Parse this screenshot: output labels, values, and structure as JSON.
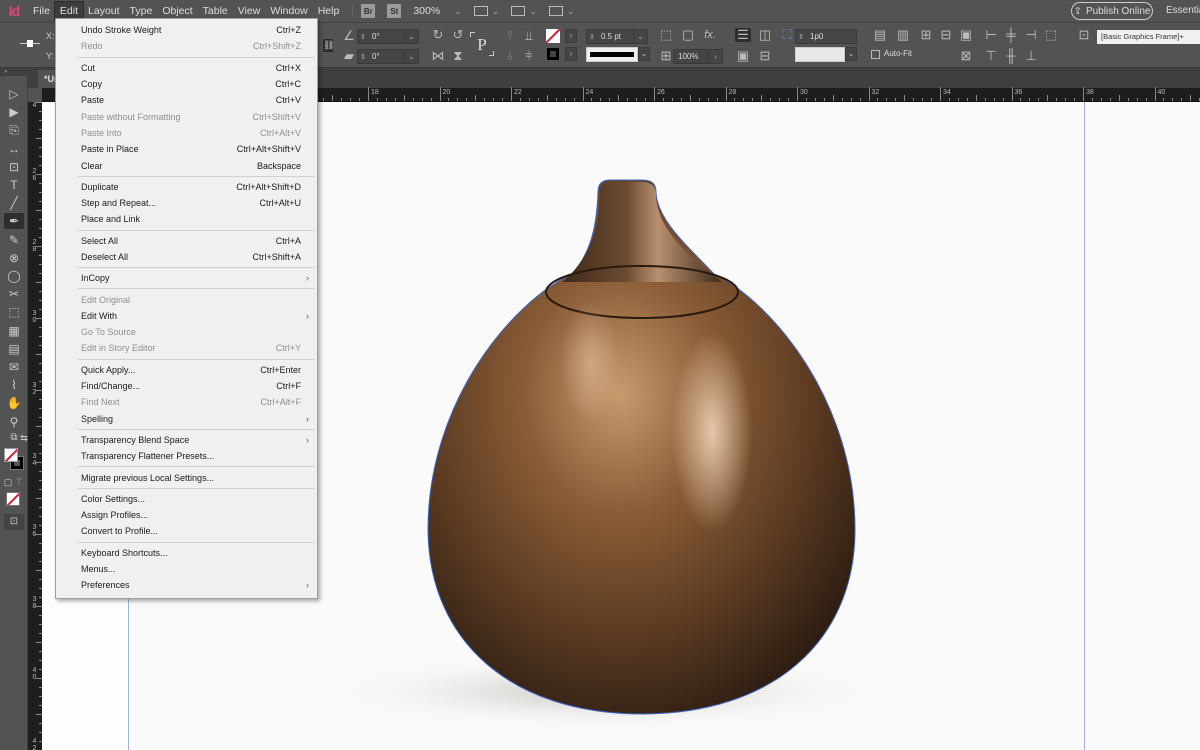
{
  "app": {
    "logo": "Id",
    "name": "Adobe InDesign"
  },
  "menubar": {
    "items": [
      "File",
      "Edit",
      "Layout",
      "Type",
      "Object",
      "Table",
      "View",
      "Window",
      "Help"
    ],
    "active": "Edit",
    "bridge_label": "Br",
    "stock_label": "St",
    "zoom_level": "300%",
    "publish_label": "Publish Online",
    "workspace_label": "Essentials"
  },
  "control_panel": {
    "x_label": "X:",
    "y_label": "Y:",
    "rotate_angle": "0°",
    "shear_angle": "0°",
    "stroke_weight": "0.5 pt",
    "opacity": "100%",
    "corner_size": "1p0",
    "autofit_label": "Auto-Fit",
    "autofit_checked": false,
    "object_style": "[Basic Graphics Frame]+",
    "fill_color": "none",
    "stroke_color": "#000000",
    "type_on_path_label": "P",
    "fx_label": "fx."
  },
  "document": {
    "tab_label": "*Un",
    "tools_header": "»"
  },
  "rulers": {
    "horizontal": [
      "18",
      "20",
      "22",
      "24",
      "26",
      "28",
      "30",
      "32",
      "34",
      "36",
      "38",
      "40"
    ],
    "vertical": [
      "4",
      "26",
      "28",
      "30",
      "32",
      "34",
      "36",
      "38",
      "40",
      "42"
    ]
  },
  "edit_menu": {
    "groups": [
      [
        {
          "label": "Undo Stroke Weight",
          "shortcut": "Ctrl+Z",
          "enabled": true
        },
        {
          "label": "Redo",
          "shortcut": "Ctrl+Shift+Z",
          "enabled": false
        }
      ],
      [
        {
          "label": "Cut",
          "shortcut": "Ctrl+X",
          "enabled": true
        },
        {
          "label": "Copy",
          "shortcut": "Ctrl+C",
          "enabled": true
        },
        {
          "label": "Paste",
          "shortcut": "Ctrl+V",
          "enabled": true
        },
        {
          "label": "Paste without Formatting",
          "shortcut": "Ctrl+Shift+V",
          "enabled": false
        },
        {
          "label": "Paste Into",
          "shortcut": "Ctrl+Alt+V",
          "enabled": false
        },
        {
          "label": "Paste in Place",
          "shortcut": "Ctrl+Alt+Shift+V",
          "enabled": true
        },
        {
          "label": "Clear",
          "shortcut": "Backspace",
          "enabled": true
        }
      ],
      [
        {
          "label": "Duplicate",
          "shortcut": "Ctrl+Alt+Shift+D",
          "enabled": true
        },
        {
          "label": "Step and Repeat...",
          "shortcut": "Ctrl+Alt+U",
          "enabled": true
        },
        {
          "label": "Place and Link",
          "shortcut": "",
          "enabled": true
        }
      ],
      [
        {
          "label": "Select All",
          "shortcut": "Ctrl+A",
          "enabled": true
        },
        {
          "label": "Deselect All",
          "shortcut": "Ctrl+Shift+A",
          "enabled": true
        }
      ],
      [
        {
          "label": "InCopy",
          "shortcut": "",
          "enabled": true,
          "submenu": true
        }
      ],
      [
        {
          "label": "Edit Original",
          "shortcut": "",
          "enabled": false
        },
        {
          "label": "Edit With",
          "shortcut": "",
          "enabled": true,
          "submenu": true
        },
        {
          "label": "Go To Source",
          "shortcut": "",
          "enabled": false
        },
        {
          "label": "Edit in Story Editor",
          "shortcut": "Ctrl+Y",
          "enabled": false
        }
      ],
      [
        {
          "label": "Quick Apply...",
          "shortcut": "Ctrl+Enter",
          "enabled": true
        },
        {
          "label": "Find/Change...",
          "shortcut": "Ctrl+F",
          "enabled": true
        },
        {
          "label": "Find Next",
          "shortcut": "Ctrl+Alt+F",
          "enabled": false
        },
        {
          "label": "Spelling",
          "shortcut": "",
          "enabled": true,
          "submenu": true
        }
      ],
      [
        {
          "label": "Transparency Blend Space",
          "shortcut": "",
          "enabled": true,
          "submenu": true
        },
        {
          "label": "Transparency Flattener Presets...",
          "shortcut": "",
          "enabled": true
        }
      ],
      [
        {
          "label": "Migrate previous Local Settings...",
          "shortcut": "",
          "enabled": true
        }
      ],
      [
        {
          "label": "Color Settings...",
          "shortcut": "",
          "enabled": true
        },
        {
          "label": "Assign Profiles...",
          "shortcut": "",
          "enabled": true
        },
        {
          "label": "Convert to Profile...",
          "shortcut": "",
          "enabled": true
        }
      ],
      [
        {
          "label": "Keyboard Shortcuts...",
          "shortcut": "",
          "enabled": true
        },
        {
          "label": "Menus...",
          "shortcut": "",
          "enabled": true
        },
        {
          "label": "Preferences",
          "shortcut": "",
          "enabled": true,
          "submenu": true
        }
      ]
    ],
    "submenu_glyph": "›"
  },
  "tools": [
    {
      "name": "selection-tool",
      "glyph": "▷"
    },
    {
      "name": "direct-selection-tool",
      "glyph": "▶"
    },
    {
      "name": "page-tool",
      "glyph": "⎘"
    },
    {
      "name": "gap-tool",
      "glyph": "↔"
    },
    {
      "name": "content-collector-tool",
      "glyph": "⊡"
    },
    {
      "name": "type-tool",
      "glyph": "T"
    },
    {
      "name": "line-tool",
      "glyph": "╱"
    },
    {
      "name": "pen-tool",
      "glyph": "✒",
      "selected": true
    },
    {
      "name": "pencil-tool",
      "glyph": "✎"
    },
    {
      "name": "rectangle-frame-tool",
      "glyph": "⊗"
    },
    {
      "name": "ellipse-tool",
      "glyph": "◯"
    },
    {
      "name": "scissors-tool",
      "glyph": "✂"
    },
    {
      "name": "free-transform-tool",
      "glyph": "⬚"
    },
    {
      "name": "gradient-swatch-tool",
      "glyph": "▦"
    },
    {
      "name": "gradient-feather-tool",
      "glyph": "▤"
    },
    {
      "name": "note-tool",
      "glyph": "✉"
    },
    {
      "name": "eyedropper-tool",
      "glyph": "⌇"
    },
    {
      "name": "hand-tool",
      "glyph": "✋"
    },
    {
      "name": "zoom-tool",
      "glyph": "⚲"
    }
  ],
  "colors": {
    "ui_bg": "#535353",
    "menu_bg": "#f0f0f0",
    "ruler_bg": "#1e1e1e",
    "accent_brand": "#e8457b",
    "selection_path": "#3a66c9",
    "guide": "#9cb8d6"
  }
}
